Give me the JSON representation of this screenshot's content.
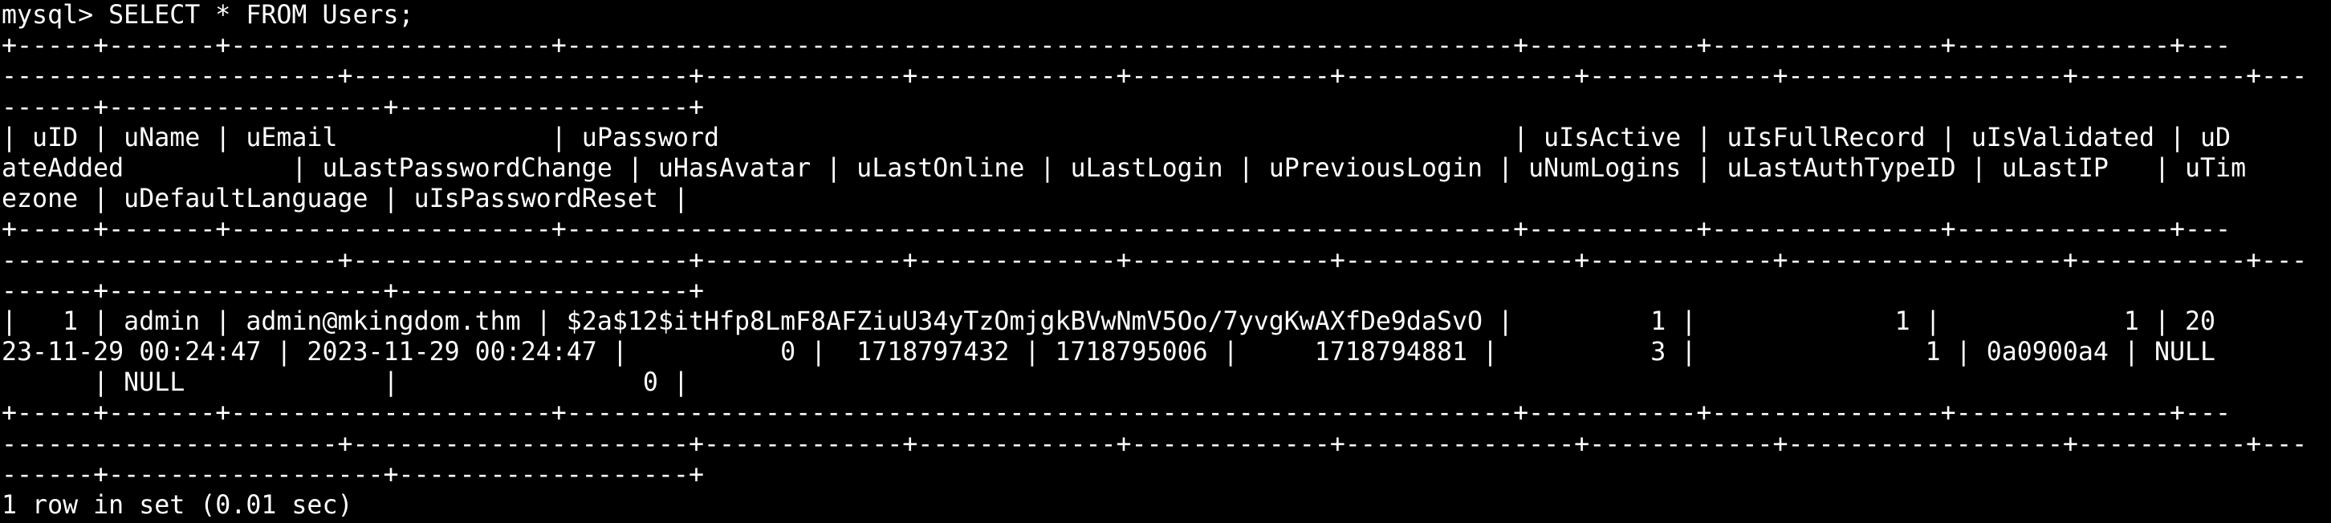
{
  "terminal": {
    "prompt": "mysql> ",
    "command": "SELECT * FROM Users;",
    "table_lines": [
      "+-----+-------+---------------------+--------------------------------------------------------------+-----------+---------------+--------------+---",
      "----------------------+----------------------+-------------+-------------+-------------+---------------+------------+------------------+-----------+---",
      "------+------------------+-------------------+",
      "| uID | uName | uEmail              | uPassword                                                    | uIsActive | uIsFullRecord | uIsValidated | uD",
      "ateAdded           | uLastPasswordChange | uHasAvatar | uLastOnline | uLastLogin | uPreviousLogin | uNumLogins | uLastAuthTypeID | uLastIP   | uTim",
      "ezone | uDefaultLanguage | uIsPasswordReset |",
      "+-----+-------+---------------------+--------------------------------------------------------------+-----------+---------------+--------------+---",
      "----------------------+----------------------+-------------+-------------+-------------+---------------+------------+------------------+-----------+---",
      "------+------------------+-------------------+",
      "|   1 | admin | admin@mkingdom.thm | $2a$12$itHfp8LmF8AFZiuU34yTzOmjgkBVwNmV5Oo/7yvgKwAXfDe9daSvO |         1 |             1 |            1 | 20",
      "23-11-29 00:24:47 | 2023-11-29 00:24:47 |          0 |  1718797432 | 1718795006 |     1718794881 |          3 |               1 | 0a0900a4 | NULL",
      "      | NULL             |                0 |",
      "+-----+-------+---------------------+--------------------------------------------------------------+-----------+---------------+--------------+---",
      "----------------------+----------------------+-------------+-------------+-------------+---------------+------------+------------------+-----------+---",
      "------+------------------+-------------------+"
    ],
    "result_summary": "1 row in set (0.01 sec)"
  }
}
